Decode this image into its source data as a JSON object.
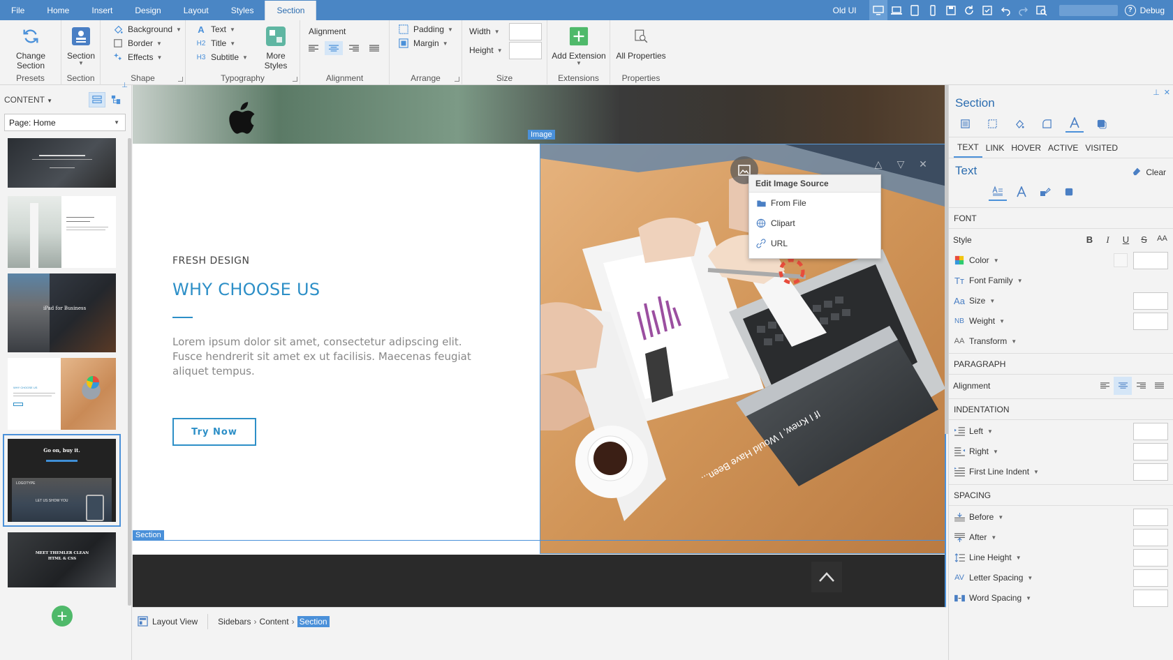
{
  "menubar": {
    "tabs": [
      "File",
      "Home",
      "Insert",
      "Design",
      "Layout",
      "Styles",
      "Section"
    ],
    "active_tab": "Section",
    "old_ui": "Old UI",
    "debug": "Debug",
    "help_glyph": "?"
  },
  "ribbon": {
    "presets": {
      "button": "Change Section",
      "label": "Presets"
    },
    "section": {
      "button": "Section",
      "label": "Section"
    },
    "shape": {
      "background": "Background",
      "border": "Border",
      "effects": "Effects",
      "label": "Shape"
    },
    "typography": {
      "text": "Text",
      "title": "Title",
      "subtitle": "Subtitle",
      "h2": "H2",
      "h3": "H3",
      "more_styles": "More Styles",
      "label": "Typography"
    },
    "alignment": {
      "heading": "Alignment",
      "label": "Alignment"
    },
    "arrange": {
      "padding": "Padding",
      "margin": "Margin",
      "label": "Arrange"
    },
    "size": {
      "width": "Width",
      "height": "Height",
      "label": "Size"
    },
    "extensions": {
      "button": "Add Extension",
      "label": "Extensions"
    },
    "properties": {
      "button": "All Properties",
      "label": "Properties"
    }
  },
  "left": {
    "header": "CONTENT",
    "page_select": "Page: Home",
    "thumbs": [
      {
        "id": "thumb-1",
        "selected": false
      },
      {
        "id": "thumb-2",
        "selected": false
      },
      {
        "id": "thumb-3",
        "selected": false,
        "text": "iPad for Business"
      },
      {
        "id": "thumb-4",
        "selected": false,
        "text": "WHY CHOOSE US"
      },
      {
        "id": "thumb-5",
        "selected": true,
        "text": "Go on, buy it.",
        "sub": "LET US SHOW YOU",
        "logo": "LOGOTYPE"
      },
      {
        "id": "thumb-6",
        "selected": false,
        "text": "MEET THEMLER CLEAN HTML & CSS"
      }
    ],
    "add_glyph": "+"
  },
  "canvas": {
    "kicker": "FRESH DESIGN",
    "heading": "WHY CHOOSE US",
    "body": "Lorem ipsum dolor sit amet, consectetur adipscing elit. Fusce hendrerit sit amet ex ut facilisis. Maecenas feugiat aliquet tempus.",
    "button": "Try Now",
    "image_tag": "Image",
    "section_tag": "Section",
    "screen_text": "If I Knew, I Would Have Been..."
  },
  "popup": {
    "title": "Edit Image Source",
    "items": [
      "From File",
      "Clipart",
      "URL"
    ]
  },
  "bottombar": {
    "layout_view": "Layout View",
    "crumbs": [
      "Sidebars",
      "Content",
      "Section"
    ]
  },
  "right": {
    "title": "Section",
    "tabs": [
      "TEXT",
      "LINK",
      "HOVER",
      "ACTIVE",
      "VISITED"
    ],
    "subtitle": "Text",
    "clear": "Clear",
    "font": {
      "heading": "FONT",
      "style": "Style",
      "style_buttons": [
        "B",
        "I",
        "U",
        "S",
        "AA"
      ],
      "color": "Color",
      "font_family": "Font Family",
      "size": "Size",
      "weight": "Weight",
      "transform": "Transform"
    },
    "paragraph": {
      "heading": "PARAGRAPH",
      "alignment": "Alignment"
    },
    "indentation": {
      "heading": "INDENTATION",
      "left": "Left",
      "right": "Right",
      "first": "First Line Indent"
    },
    "spacing": {
      "heading": "SPACING",
      "before": "Before",
      "after": "After",
      "line_height": "Line Height",
      "letter": "Letter Spacing",
      "word": "Word Spacing"
    }
  },
  "colors": {
    "accent": "#4a86c5",
    "heading_blue": "#2d8fc7",
    "add_green": "#4fb96a"
  }
}
